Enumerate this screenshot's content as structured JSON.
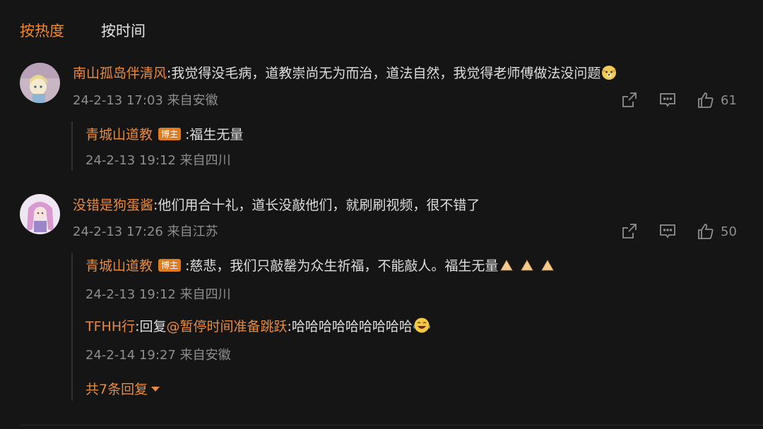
{
  "tabs": {
    "hot": "按热度",
    "time": "按时间"
  },
  "colors": {
    "accent": "#f08a2c",
    "username": "#e98a3d",
    "background": "#151515",
    "meta": "#8e8e8e",
    "badge": "#e07b1f"
  },
  "comments": [
    {
      "user": "南山孤岛伴清风",
      "text": ":我觉得没毛病，道教崇尚无为而治，道法自然，我觉得老师傅做法没问题",
      "emoji": "dog-face-emoji",
      "time": "24-2-13 17:03 来自安徽",
      "likes": "61",
      "replies": [
        {
          "user": "青城山道教",
          "badge": "博主",
          "text": ":福生无量",
          "time": "24-2-13 19:12 来自四川"
        }
      ]
    },
    {
      "user": "没错是狗蛋酱",
      "text": ":他们用合十礼，道长没敲他们，就刷刷视频，很不错了",
      "time": "24-2-13 17:26 来自江苏",
      "likes": "50",
      "replies": [
        {
          "user": "青城山道教",
          "badge": "博主",
          "text": ":慈悲，我们只敲罄为众生祈福，不能敲人。福生无量",
          "emoji": "folded-hands-emoji",
          "time": "24-2-13 19:12 来自四川"
        },
        {
          "user": "TFHH行",
          "reply_prefix": ":回复",
          "mention": "@暂停时间准备跳跃",
          "text": ":哈哈哈哈哈哈哈哈哈",
          "emoji": "laughing-tears-emoji",
          "time": "24-2-14 19:27 来自安徽"
        }
      ],
      "more_replies": "共7条回复"
    }
  ]
}
